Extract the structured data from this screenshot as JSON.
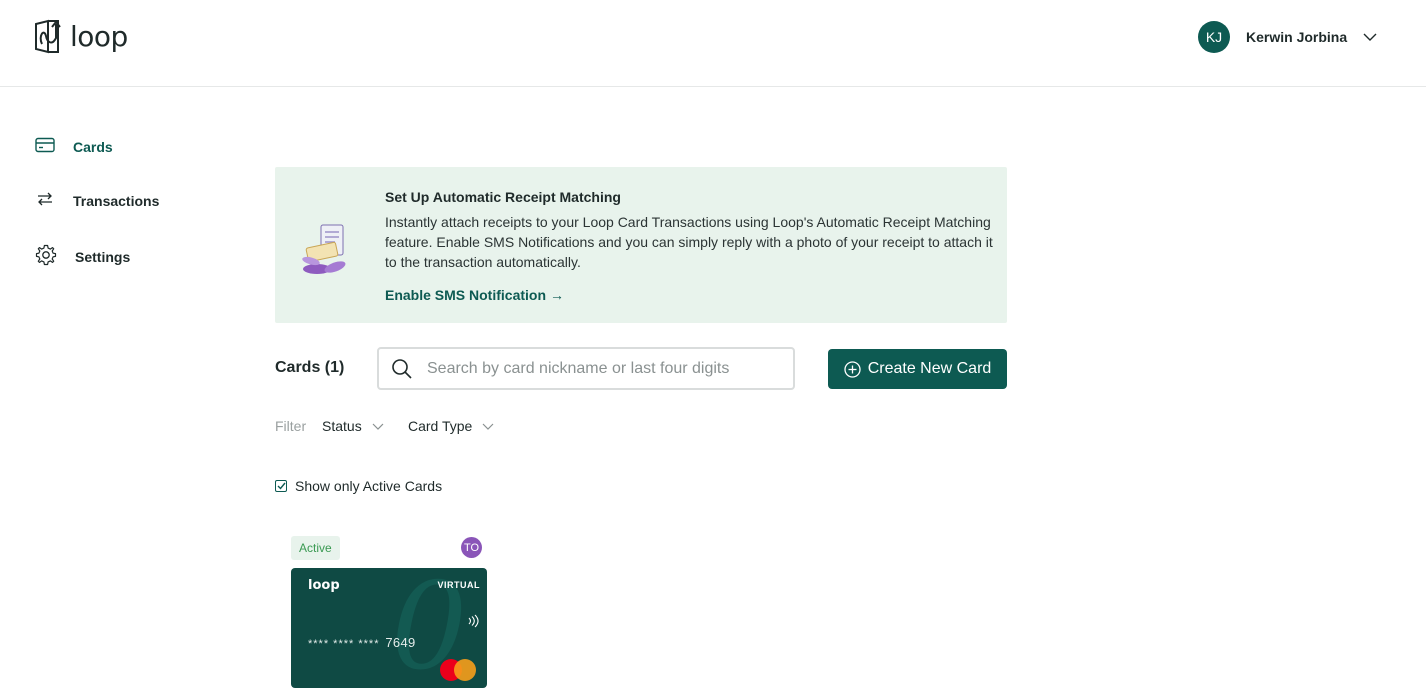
{
  "brand": {
    "name": "loop",
    "accent": "#0d5a52"
  },
  "user": {
    "initials": "KJ",
    "name": "Kerwin Jorbina"
  },
  "sidebar": {
    "items": [
      {
        "label": "Cards",
        "icon": "credit-card-icon",
        "active": true
      },
      {
        "label": "Transactions",
        "icon": "arrows-swap-icon",
        "active": false
      },
      {
        "label": "Settings",
        "icon": "gear-icon",
        "active": false
      }
    ]
  },
  "banner": {
    "title": "Set Up Automatic Receipt Matching",
    "body": "Instantly attach receipts to your Loop Card Transactions using Loop's Automatic Receipt Matching feature. Enable SMS Notifications and you can simply reply with a photo of your receipt to attach it to the transaction automatically.",
    "link_label": "Enable SMS Notification",
    "link_arrow": "→"
  },
  "cards_section": {
    "title": "Cards (1)",
    "search_placeholder": "Search by card nickname or last four digits",
    "create_label": "Create New Card"
  },
  "filters": {
    "label": "Filter",
    "status_label": "Status",
    "card_type_label": "Card Type"
  },
  "active_toggle": {
    "label": "Show only Active Cards",
    "checked": true
  },
  "cards": [
    {
      "status": "Active",
      "owner_initials": "TO",
      "brand": "loop",
      "type": "VIRTUAL",
      "masked": "**** **** ****",
      "last4": "7649"
    }
  ]
}
